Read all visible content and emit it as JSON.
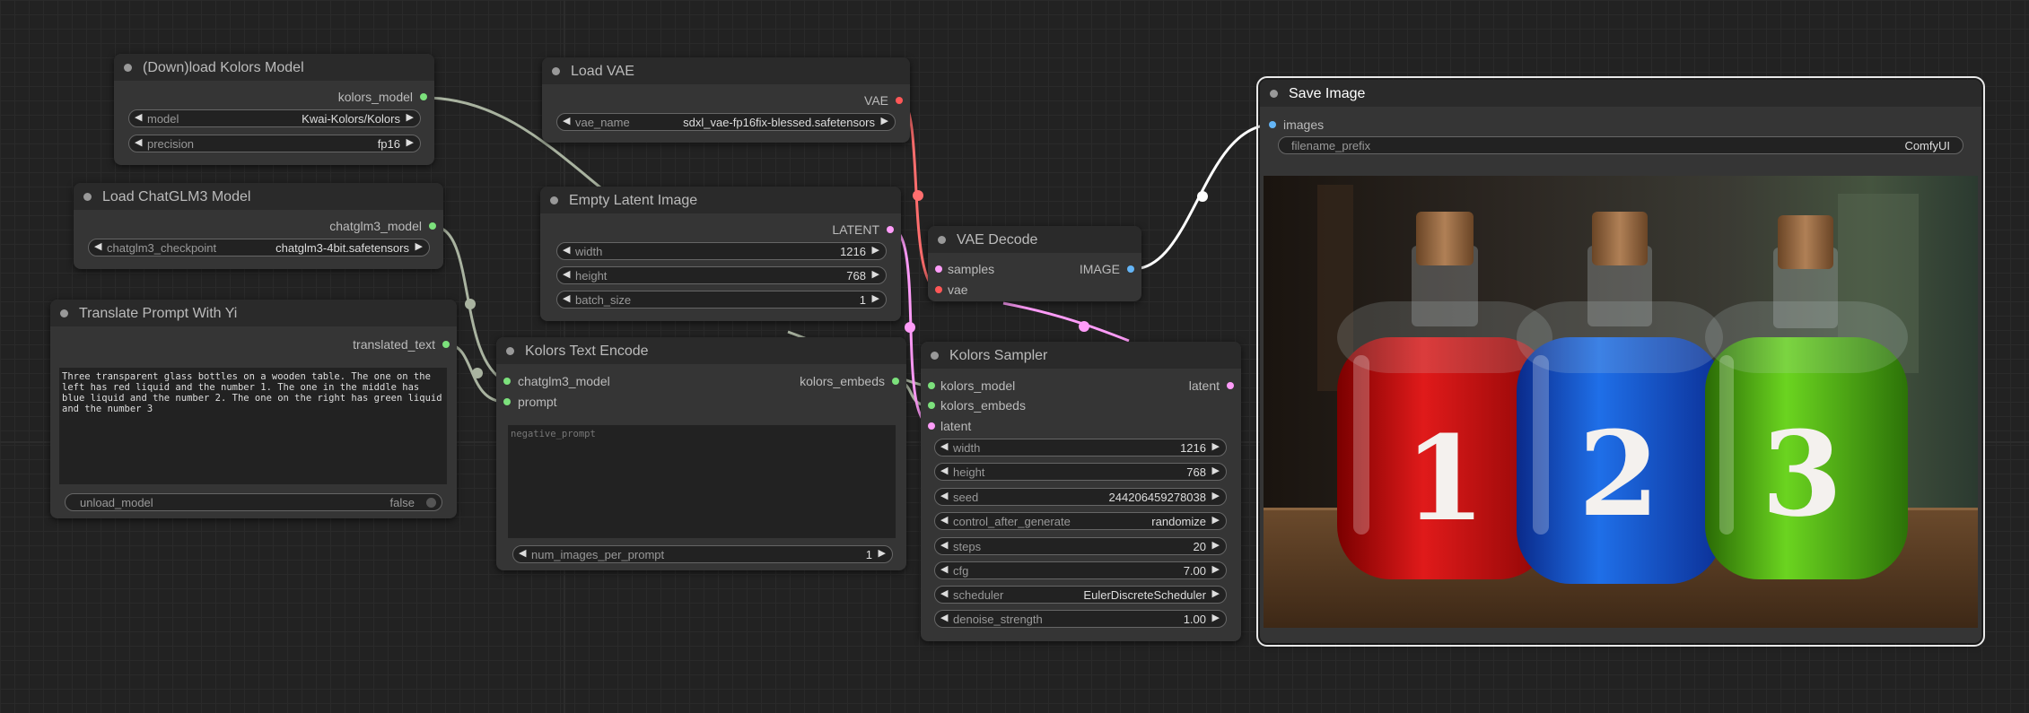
{
  "kolors_loader": {
    "title": "(Down)load Kolors Model",
    "output": "kolors_model",
    "widgets": [
      {
        "label": "model",
        "value": "Kwai-Kolors/Kolors"
      },
      {
        "label": "precision",
        "value": "fp16"
      }
    ]
  },
  "chatglm_loader": {
    "title": "Load ChatGLM3 Model",
    "output": "chatglm3_model",
    "widgets": [
      {
        "label": "chatglm3_checkpoint",
        "value": "chatglm3-4bit.safetensors"
      }
    ]
  },
  "translate": {
    "title": "Translate Prompt With Yi",
    "output": "translated_text",
    "text": "Three transparent glass bottles on a wooden table. The one on the left has red liquid and the number 1. The one in the middle has blue liquid and the number 2. The one on the right has green liquid and the number 3",
    "toggle": {
      "label": "unload_model",
      "value": "false"
    }
  },
  "load_vae": {
    "title": "Load VAE",
    "output": "VAE",
    "widgets": [
      {
        "label": "vae_name",
        "value": "sdxl_vae-fp16fix-blessed.safetensors"
      }
    ]
  },
  "empty_latent": {
    "title": "Empty Latent Image",
    "output": "LATENT",
    "widgets": [
      {
        "label": "width",
        "value": "1216"
      },
      {
        "label": "height",
        "value": "768"
      },
      {
        "label": "batch_size",
        "value": "1"
      }
    ]
  },
  "text_encode": {
    "title": "Kolors Text Encode",
    "inputs": [
      "chatglm3_model",
      "prompt"
    ],
    "output": "kolors_embeds",
    "negative_placeholder": "negative_prompt",
    "widgets": [
      {
        "label": "num_images_per_prompt",
        "value": "1"
      }
    ]
  },
  "vae_decode": {
    "title": "VAE Decode",
    "inputs": [
      "samples",
      "vae"
    ],
    "output": "IMAGE"
  },
  "sampler": {
    "title": "Kolors Sampler",
    "inputs": [
      "kolors_model",
      "kolors_embeds",
      "latent"
    ],
    "output": "latent",
    "widgets": [
      {
        "label": "width",
        "value": "1216"
      },
      {
        "label": "height",
        "value": "768"
      },
      {
        "label": "seed",
        "value": "244206459278038"
      },
      {
        "label": "control_after_generate",
        "value": "randomize"
      },
      {
        "label": "steps",
        "value": "20"
      },
      {
        "label": "cfg",
        "value": "7.00"
      },
      {
        "label": "scheduler",
        "value": "EulerDiscreteScheduler"
      },
      {
        "label": "denoise_strength",
        "value": "1.00"
      }
    ]
  },
  "save_image": {
    "title": "Save Image",
    "input": "images",
    "widgets": [
      {
        "label": "filename_prefix",
        "value": "ComfyUI"
      }
    ],
    "bottle_labels": [
      "1",
      "2",
      "3"
    ]
  },
  "colors": {
    "canvas": "#222222",
    "node": "#353535",
    "node_title": "#2a2a2a",
    "model_link": "#a9b3a0",
    "vae_link": "#ff6e6e",
    "latent_link": "#ff9cf9",
    "image_link": "#ffffff",
    "image_socket": "#64b5f6"
  }
}
